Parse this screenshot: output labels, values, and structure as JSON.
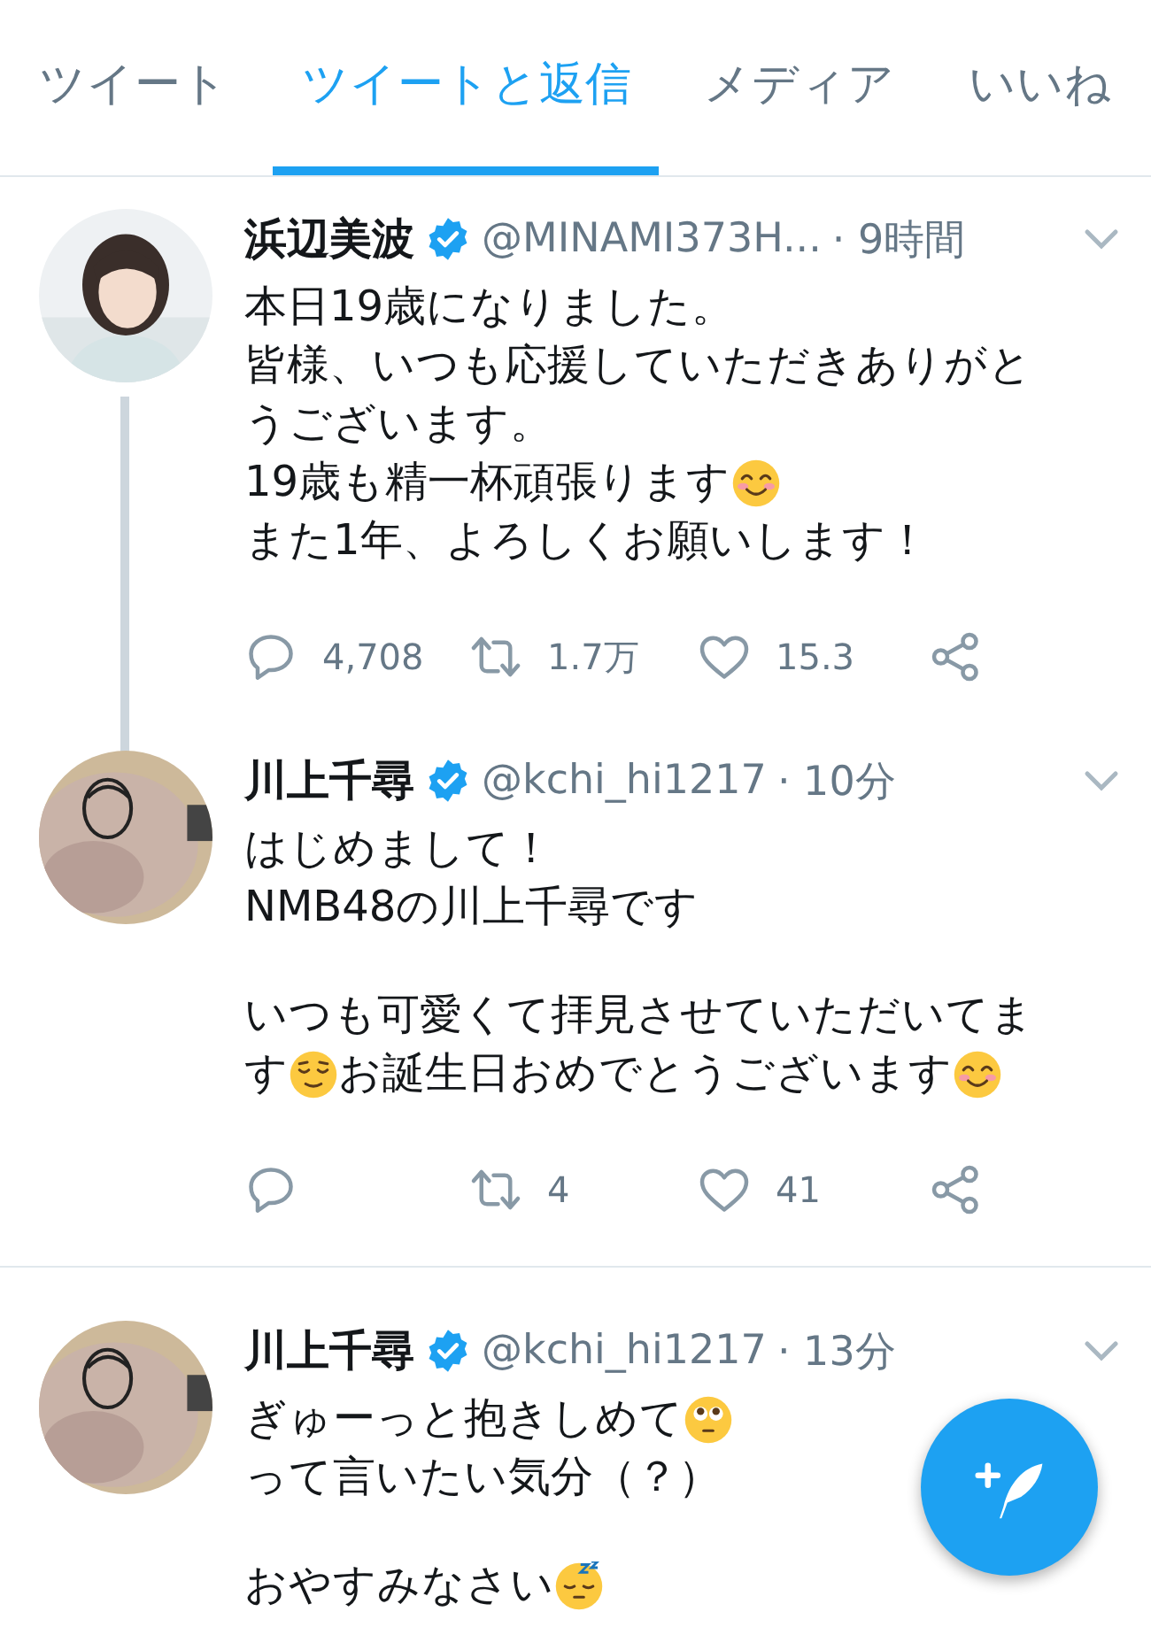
{
  "tabs": [
    {
      "label": "ツイート",
      "selected": false
    },
    {
      "label": "ツイートと返信",
      "selected": true
    },
    {
      "label": "メディア",
      "selected": false
    },
    {
      "label": "いいね",
      "selected": false
    }
  ],
  "tweets": [
    {
      "thread": true,
      "name": "浜辺美波",
      "verified": true,
      "handle": "@MINAMI373H...",
      "time": "· 9時間",
      "paragraphs": [
        [
          [
            {
              "kind": "text",
              "text": "本日19歳になりました。"
            }
          ],
          [
            {
              "kind": "text",
              "text": "皆様、いつも応援していただきありがと"
            }
          ],
          [
            {
              "kind": "text",
              "text": "うございます。"
            }
          ],
          [
            {
              "kind": "text",
              "text": "19歳も精一杯頑張ります"
            },
            {
              "kind": "smiling"
            }
          ],
          [
            {
              "kind": "text",
              "text": "また1年、よろしくお願いします！"
            }
          ]
        ]
      ],
      "actions": [
        {
          "kind": "reply",
          "count": "4,708"
        },
        {
          "kind": "retweet",
          "count": "1.7万"
        },
        {
          "kind": "like",
          "count": "15.3"
        },
        {
          "kind": "share"
        }
      ]
    },
    {
      "thread": false,
      "name": "川上千尋",
      "verified": true,
      "handle": "@kchi_hi1217",
      "time": "· 10分",
      "paragraphs": [
        [
          [
            {
              "kind": "text",
              "text": "はじめまして！"
            }
          ],
          [
            {
              "kind": "text",
              "text": "NMB48の川上千尋です"
            }
          ]
        ],
        [
          [
            {
              "kind": "text",
              "text": "いつも可愛くて拝見させていただいてま"
            }
          ],
          [
            {
              "kind": "text",
              "text": "す"
            },
            {
              "kind": "relieved"
            },
            {
              "kind": "text",
              "text": "お誕生日おめでとうございます"
            },
            {
              "kind": "smiling"
            }
          ]
        ]
      ],
      "actions": [
        {
          "kind": "reply"
        },
        {
          "kind": "retweet",
          "count": "4"
        },
        {
          "kind": "like",
          "count": "41"
        },
        {
          "kind": "share"
        }
      ]
    },
    {
      "thread": false,
      "name": "川上千尋",
      "verified": true,
      "handle": "@kchi_hi1217",
      "time": "· 13分",
      "paragraphs": [
        [
          [
            {
              "kind": "text",
              "text": "ぎゅーっと抱きしめて"
            },
            {
              "kind": "pleading"
            }
          ],
          [
            {
              "kind": "text",
              "text": "って言いたい気分（？）"
            }
          ]
        ],
        [
          [
            {
              "kind": "text",
              "text": "おやすみなさい"
            },
            {
              "kind": "sleeping"
            }
          ]
        ]
      ]
    }
  ]
}
